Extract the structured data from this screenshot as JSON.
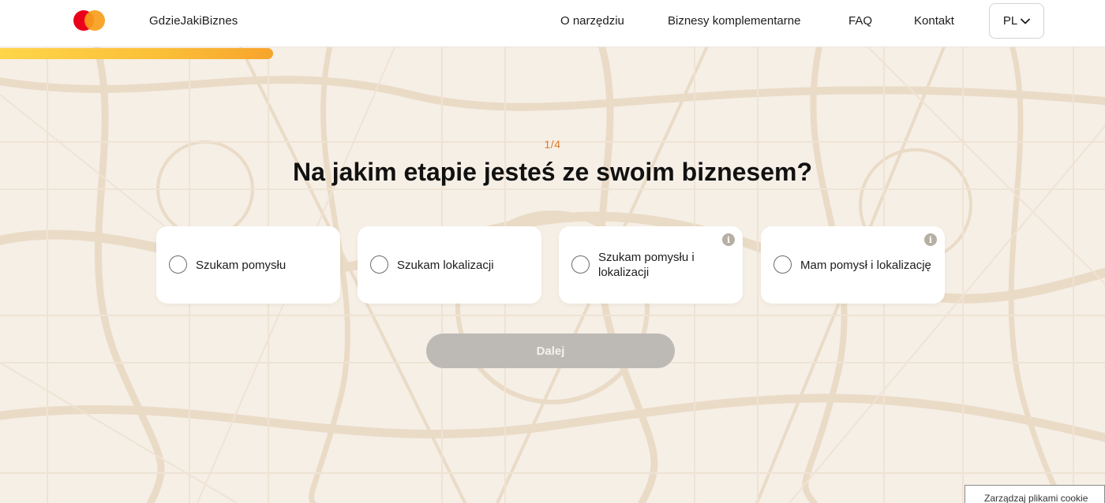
{
  "brand": {
    "name": "GdzieJakiBiznes",
    "logo_icon": "mastercard-logo-icon"
  },
  "nav": {
    "links": [
      "O narzędziu",
      "Biznesy komplementarne",
      "FAQ",
      "Kontakt"
    ],
    "language": "PL"
  },
  "quiz": {
    "progress": 0.25,
    "step": "1/4",
    "question": "Na jakim etapie jesteś ze swoim biznesem?",
    "options": [
      {
        "label": "Szukam pomysłu",
        "info": false
      },
      {
        "label": "Szukam lokalizacji",
        "info": false
      },
      {
        "label": "Szukam pomysłu i lokalizacji",
        "info": true
      },
      {
        "label": "Mam pomysł i lokalizację",
        "info": true
      }
    ],
    "info_glyph": "i",
    "next_label": "Dalej"
  },
  "cookie": {
    "label": "Zarządzaj plikami cookie"
  },
  "colors": {
    "accent": "#e07a2c",
    "progress": "#fbbe37",
    "background": "#f6efe6",
    "button_disabled": "#bdbab6"
  }
}
